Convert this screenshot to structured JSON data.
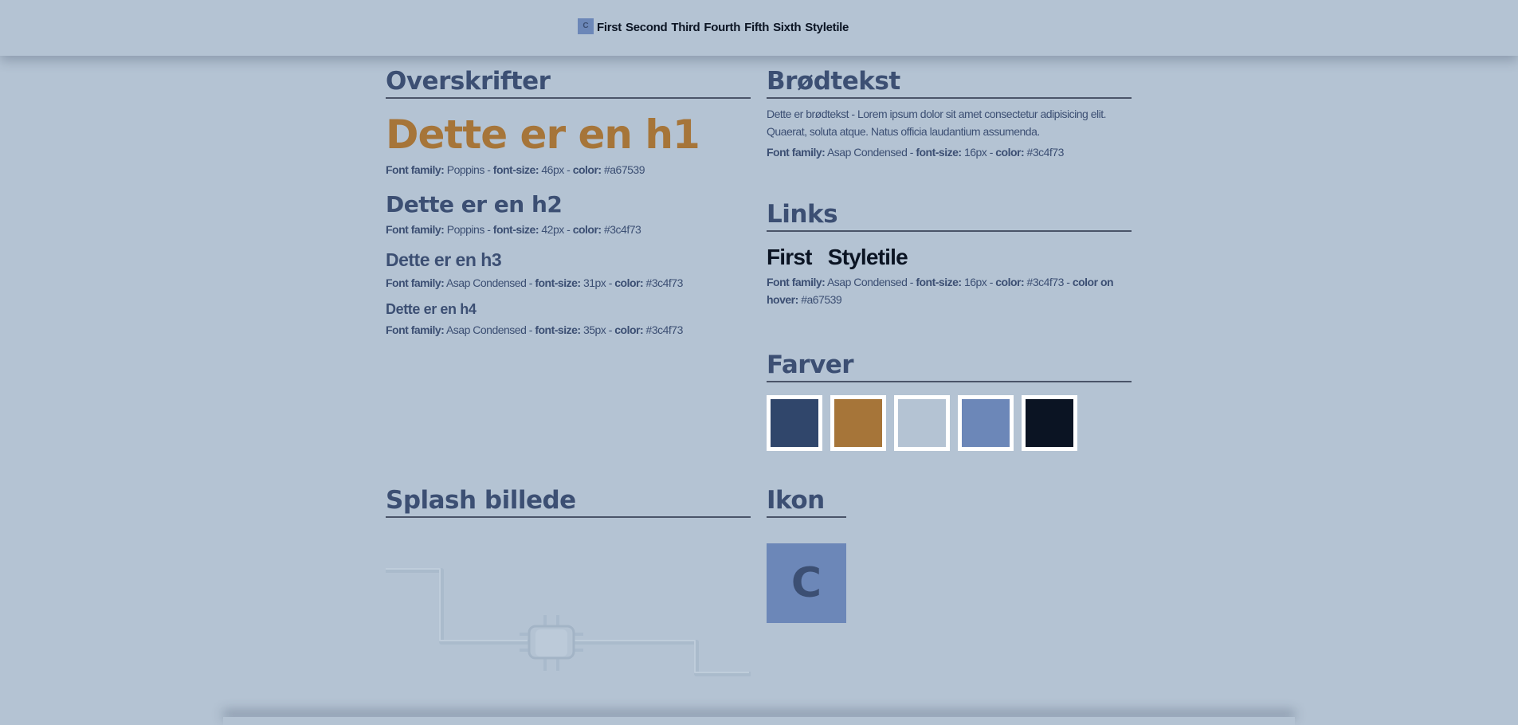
{
  "nav": {
    "logo": "C",
    "links": [
      "First",
      "Second",
      "Third",
      "Fourth",
      "Fifth",
      "Sixth",
      "Styletile"
    ]
  },
  "headings": {
    "title": "Overskrifter",
    "h1": {
      "text": "Dette er en h1",
      "spec_family": "Poppins",
      "spec_size": "46px",
      "spec_color": "#a67539"
    },
    "h2": {
      "text": "Dette er en h2",
      "spec_family": "Poppins",
      "spec_size": "42px",
      "spec_color": "#3c4f73"
    },
    "h3": {
      "text": "Dette er en h3",
      "spec_family": "Asap Condensed",
      "spec_size": "31px",
      "spec_color": "#3c4f73"
    },
    "h4": {
      "text": "Dette er en h4",
      "spec_family": "Asap Condensed",
      "spec_size": "35px",
      "spec_color": "#3c4f73"
    }
  },
  "labels": {
    "font_family": "Font family:",
    "font_size": "font-size:",
    "color": "color:",
    "color_hover": "color on hover:",
    "sep": " - "
  },
  "body": {
    "title": "Brødtekst",
    "text": "Dette er brødtekst - Lorem ipsum dolor sit amet consectetur adipisicing elit. Quaerat, soluta atque. Natus officia laudantium assumenda.",
    "spec_family": "Asap Condensed",
    "spec_size": "16px",
    "spec_color": "#3c4f73"
  },
  "links": {
    "title": "Links",
    "items": [
      "First",
      "Styletile"
    ],
    "spec_family": "Asap Condensed",
    "spec_size": "16px",
    "spec_color": "#3c4f73",
    "spec_hover": "#a67539"
  },
  "colors": {
    "title": "Farver",
    "swatches": [
      "#30466b",
      "#a67539",
      "#b4c3d3",
      "#6c87b8",
      "#0b1423"
    ]
  },
  "splash": {
    "title": "Splash billede"
  },
  "icon": {
    "title": "Ikon",
    "glyph": "C"
  }
}
